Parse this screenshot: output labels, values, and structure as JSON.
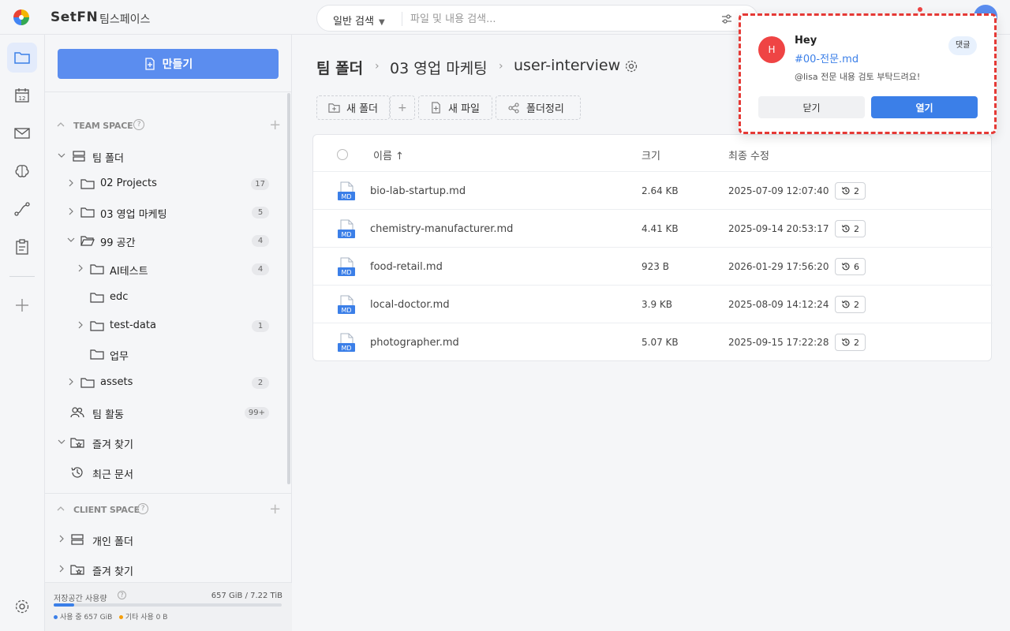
{
  "app": {
    "brand": "SetFN",
    "space_name": "팀스페이스"
  },
  "search": {
    "mode_label": "일반 검색",
    "placeholder": "파일 및 내용 검색..."
  },
  "sidebar": {
    "create_label": "만들기",
    "team_space": {
      "header": "TEAM SPACE",
      "team_folder": "팀 폴더",
      "items": [
        {
          "label": "02 Projects",
          "count": "17"
        },
        {
          "label": "03 영업 마케팅",
          "count": "5"
        },
        {
          "label": "99 공간",
          "count": "4"
        },
        {
          "label": "AI테스트",
          "count": "4"
        },
        {
          "label": "edc",
          "count": ""
        },
        {
          "label": "test-data",
          "count": "1"
        },
        {
          "label": "업무",
          "count": ""
        },
        {
          "label": "assets",
          "count": "2"
        }
      ],
      "activity": {
        "label": "팀 활동",
        "count": "99+"
      },
      "favorites": "즐겨 찾기",
      "recent": "최근 문서"
    },
    "client_space": {
      "header": "CLIENT SPACE",
      "personal": "개인 폴더",
      "favorites": "즐겨 찾기"
    },
    "storage": {
      "title": "저장공간 사용량",
      "amount": "657 GiB / 7.22 TiB",
      "used_label": "사용 중 657 GiB",
      "other_label": "기타 사용 0 B",
      "used_fraction": 0.089,
      "used_color": "#3b7fe8",
      "other_color": "#f59e0b"
    }
  },
  "main": {
    "breadcrumb": [
      "팀 폴더",
      "03 영업 마케팅",
      "user-interview"
    ],
    "toolbar": {
      "new_folder": "새 폴더",
      "new_file": "새 파일",
      "organize": "폴더정리"
    },
    "columns": {
      "name": "이름 ↑",
      "size": "크기",
      "modified": "최종 수정"
    },
    "files": [
      {
        "name": "bio-lab-startup.md",
        "size": "2.64 KB",
        "modified": "2025-07-09 12:07:40",
        "versions": "2"
      },
      {
        "name": "chemistry-manufacturer.md",
        "size": "4.41 KB",
        "modified": "2025-09-14 20:53:17",
        "versions": "2"
      },
      {
        "name": "food-retail.md",
        "size": "923 B",
        "modified": "2026-01-29 17:56:20",
        "versions": "6"
      },
      {
        "name": "local-doctor.md",
        "size": "3.9 KB",
        "modified": "2025-08-09 14:12:24",
        "versions": "2"
      },
      {
        "name": "photographer.md",
        "size": "5.07 KB",
        "modified": "2025-09-15 17:22:28",
        "versions": "2"
      }
    ],
    "md_badge": "MD"
  },
  "notification": {
    "avatar_letter": "H",
    "sender": "Hey",
    "file": "#00-전문.md",
    "message": "@lisa 전문 내용 검토 부탁드려요!",
    "tag": "댓글",
    "close_label": "닫기",
    "open_label": "열기"
  },
  "colors": {
    "accent": "#3b7fe8",
    "create_button": "#5b8def",
    "alert": "#ef4444"
  }
}
